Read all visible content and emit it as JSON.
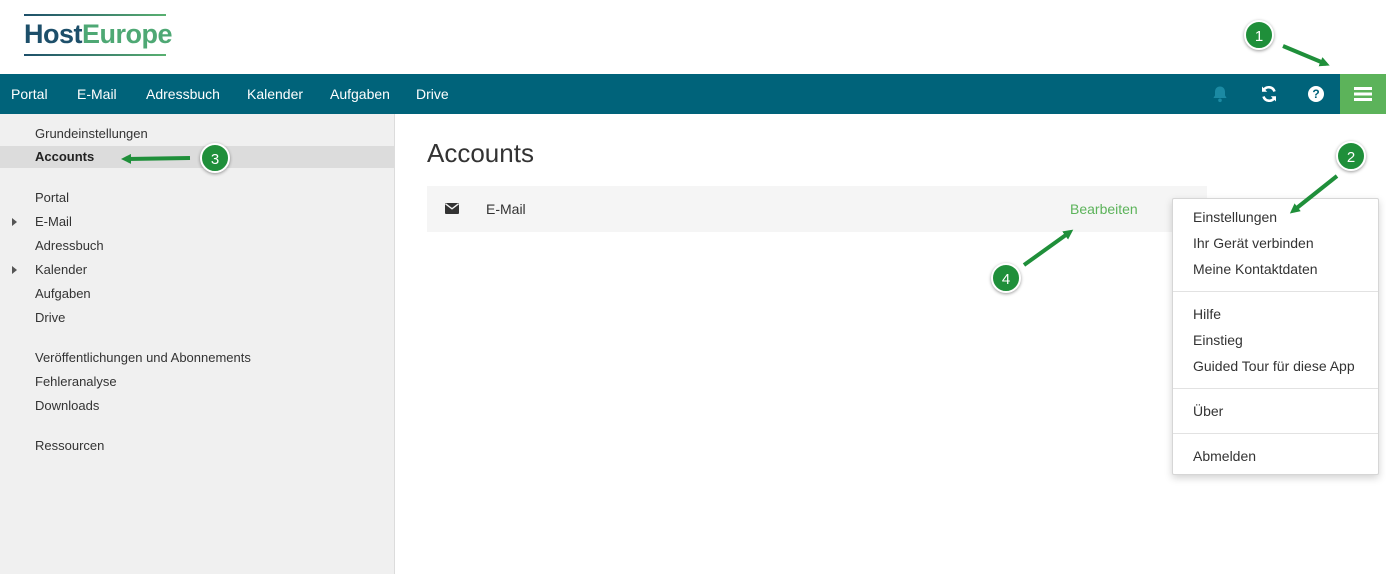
{
  "logo": {
    "part1": "Host",
    "part2": "Europe"
  },
  "topnav": {
    "items": [
      "Portal",
      "E-Mail",
      "Adressbuch",
      "Kalender",
      "Aufgaben",
      "Drive"
    ],
    "icons": [
      "bell-icon",
      "refresh-icon",
      "help-icon",
      "menu-icon"
    ]
  },
  "sidebar": {
    "items": [
      "Grundeinstellungen",
      "Accounts",
      "Portal",
      "E-Mail",
      "Adressbuch",
      "Kalender",
      "Aufgaben",
      "Drive",
      "Veröffentlichungen und Abonnements",
      "Fehleranalyse",
      "Downloads",
      "Ressourcen"
    ],
    "selected": "Accounts"
  },
  "main": {
    "title": "Accounts",
    "accounts": [
      {
        "name": "E-Mail",
        "action": "Bearbeiten"
      }
    ]
  },
  "dropdown": {
    "items": [
      "Einstellungen",
      "Ihr Gerät verbinden",
      "Meine Kontaktdaten",
      "Hilfe",
      "Einstieg",
      "Guided Tour für diese App",
      "Über",
      "Abmelden"
    ]
  },
  "callouts": [
    "1",
    "2",
    "3",
    "4"
  ],
  "colors": {
    "nav": "#00637a",
    "accent": "#5cb35a",
    "callout": "#1f8f3a"
  }
}
